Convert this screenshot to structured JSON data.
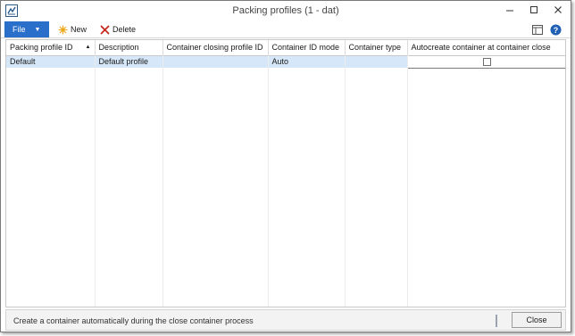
{
  "window": {
    "title": "Packing profiles (1 - dat)",
    "icons": {
      "app": "app-form-icon",
      "minimize": "minimize-icon",
      "maximize": "maximize-icon",
      "close": "close-x-icon"
    }
  },
  "ribbon": {
    "file_label": "File",
    "new_label": "New",
    "delete_label": "Delete",
    "icons": {
      "new": "new-sparkle-icon",
      "delete": "delete-x-icon",
      "layout": "layout-icon",
      "help": "help-icon"
    },
    "colors": {
      "file_bg": "#2a6fc9",
      "new_icon": "#f0a818",
      "delete_icon": "#c8281e"
    }
  },
  "grid": {
    "columns": [
      {
        "label": "Packing profile ID",
        "sorted": "ascending"
      },
      {
        "label": "Description"
      },
      {
        "label": "Container closing profile ID"
      },
      {
        "label": "Container ID mode"
      },
      {
        "label": "Container type"
      },
      {
        "label": "Autocreate container at container close"
      }
    ],
    "rows": [
      {
        "packing_profile_id": "Default",
        "description": "Default profile",
        "container_closing_profile_id": "",
        "container_id_mode": "Auto",
        "container_type": "",
        "autocreate": false,
        "selected": true
      }
    ],
    "colors": {
      "selected_row": "#d5e7f8"
    }
  },
  "status": {
    "text": "Create a container automatically during the close container process",
    "close_label": "Close"
  }
}
